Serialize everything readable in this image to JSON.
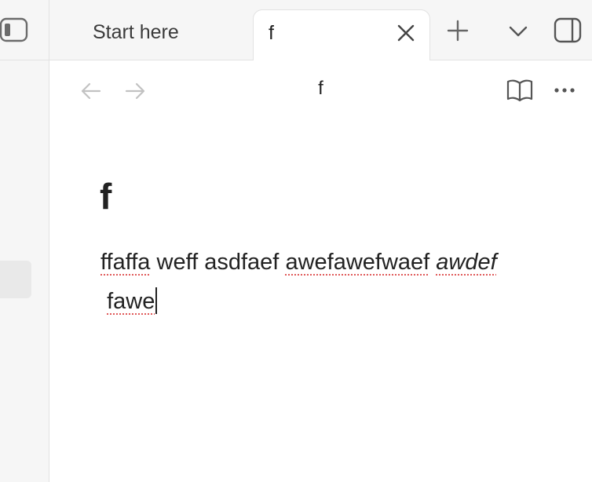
{
  "tabs": [
    {
      "label": "Start here",
      "active": false
    },
    {
      "label": "f",
      "active": true
    }
  ],
  "navbar": {
    "title": "f"
  },
  "document": {
    "title": "f",
    "body": {
      "w1": "ffaffa",
      "w2": "weff",
      "w3": "asdfaef",
      "w4": "awefawefwaef",
      "w5": "awdef",
      "w6": "fawe"
    }
  },
  "icons": {
    "sidebar_toggle": "sidebar-toggle-icon",
    "close": "close-icon",
    "new_tab": "plus-icon",
    "tab_list": "chevron-down-icon",
    "right_sidebar": "right-sidebar-icon",
    "back": "arrow-left-icon",
    "forward": "arrow-right-icon",
    "reading_view": "book-open-icon",
    "more": "more-options-icon"
  },
  "colors": {
    "sidebar_bg": "#f6f6f6",
    "spellcheck_underline": "#e05a5a",
    "text": "#222222",
    "disabled_icon": "#c2c2c2"
  }
}
